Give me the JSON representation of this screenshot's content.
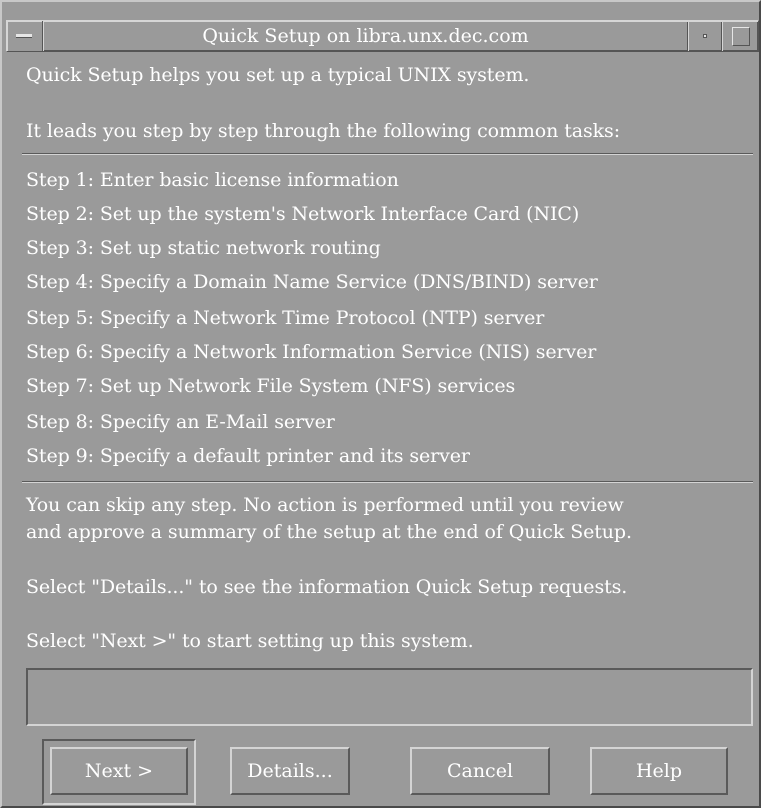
{
  "window": {
    "title": "Quick Setup on libra.unx.dec.com"
  },
  "intro": {
    "line1": "Quick Setup helps you set up a typical UNIX system.",
    "line2": "It leads you step by step through the following common tasks:"
  },
  "steps": [
    "Step 1: Enter basic license information",
    "Step 2: Set up the system's Network Interface Card (NIC)",
    "Step 3: Set up static network routing",
    "Step 4: Specify a Domain Name Service (DNS/BIND) server",
    "Step 5: Specify a Network Time Protocol (NTP) server",
    "Step 6: Specify a Network Information Service (NIS) server",
    "Step 7: Set up Network File System (NFS) services",
    "Step 8: Specify an E-Mail server",
    "Step 9: Specify a default printer and its server"
  ],
  "notes": {
    "skip_line1": "You can skip any step. No action is performed until you review",
    "skip_line2": "and approve a summary of the setup at the end of Quick Setup.",
    "details_hint": "Select \"Details...\" to see the information Quick Setup requests.",
    "next_hint": "Select \"Next >\" to start setting up this system."
  },
  "status_message": "",
  "buttons": {
    "next": "Next >",
    "details": "Details...",
    "cancel": "Cancel",
    "help": "Help"
  },
  "icons": {
    "window_menu": "window-menu-icon",
    "minimize": "minimize-icon",
    "maximize": "maximize-icon"
  }
}
